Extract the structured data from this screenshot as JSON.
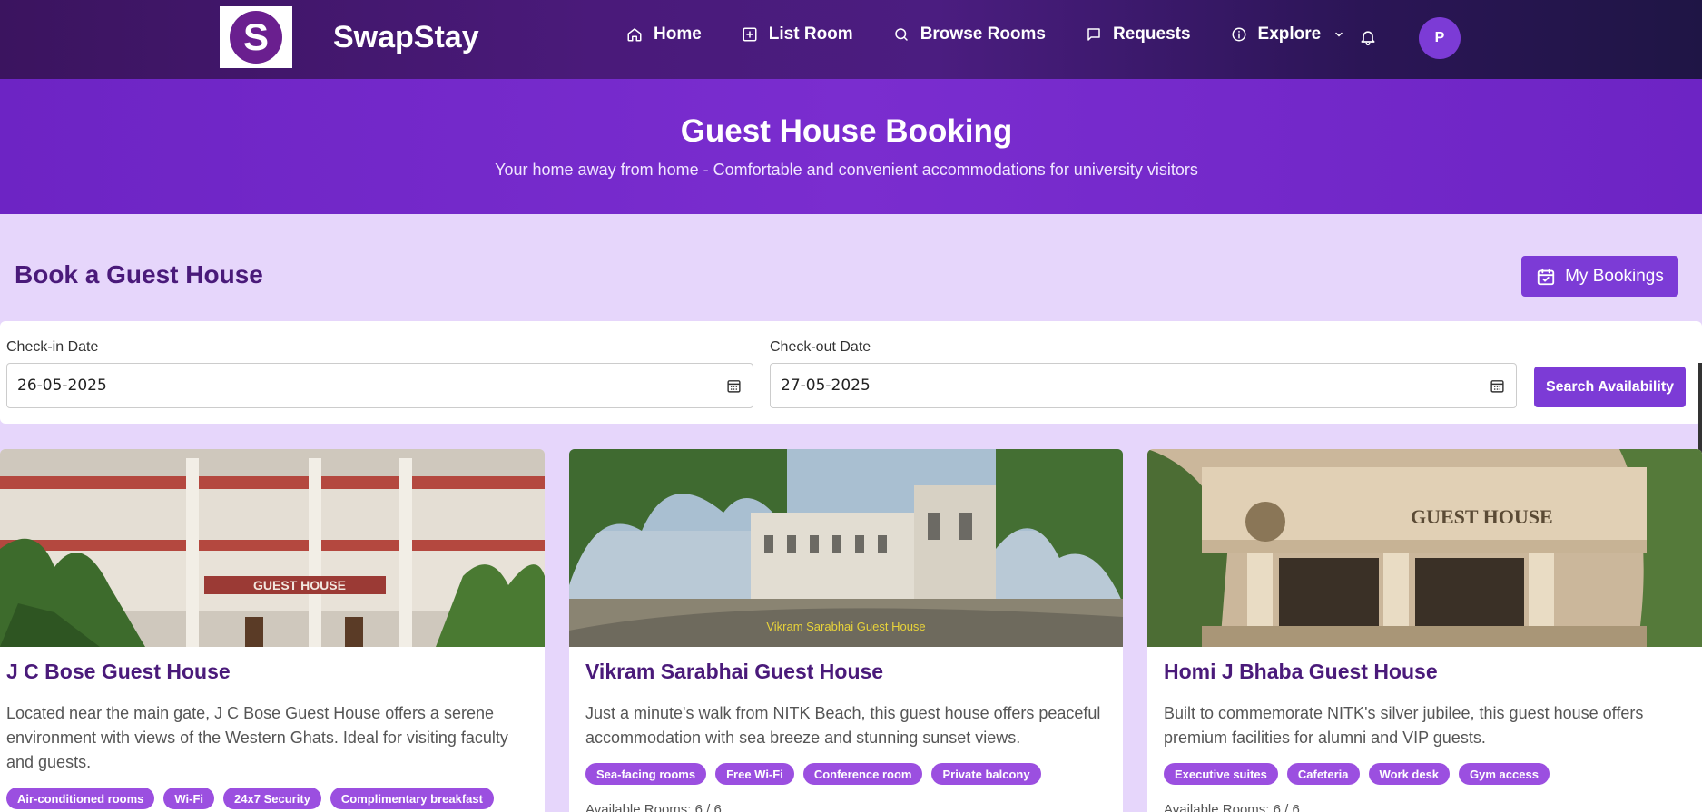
{
  "brand": {
    "logo_letter": "S",
    "name": "SwapStay"
  },
  "nav": {
    "items": [
      {
        "label": "Home",
        "icon": "home-icon"
      },
      {
        "label": "List Room",
        "icon": "plus-square-icon"
      },
      {
        "label": "Browse Rooms",
        "icon": "search-icon"
      },
      {
        "label": "Requests",
        "icon": "message-icon"
      },
      {
        "label": "Explore",
        "icon": "info-icon"
      }
    ],
    "avatar_initial": "P"
  },
  "hero": {
    "title": "Guest House Booking",
    "subtitle": "Your home away from home - Comfortable and convenient accommodations for university visitors"
  },
  "section": {
    "title": "Book a Guest House",
    "my_bookings_label": "My Bookings"
  },
  "search": {
    "checkin_label": "Check-in Date",
    "checkin_value": "26-05-2025",
    "checkout_label": "Check-out Date",
    "checkout_value": "27-05-2025",
    "button_label": "Search Availability"
  },
  "cards": [
    {
      "title": "J C Bose Guest House",
      "description": "Located near the main gate, J C Bose Guest House offers a serene environment with views of the Western Ghats. Ideal for visiting faculty and guests.",
      "image_sign": "GUEST HOUSE",
      "tags": [
        "Air-conditioned rooms",
        "Wi-Fi",
        "24x7 Security",
        "Complimentary breakfast"
      ]
    },
    {
      "title": "Vikram Sarabhai Guest House",
      "description": "Just a minute's walk from NITK Beach, this guest house offers peaceful accommodation with sea breeze and stunning sunset views.",
      "image_sign": "Vikram Sarabhai Guest House",
      "tags": [
        "Sea-facing rooms",
        "Free Wi-Fi",
        "Conference room",
        "Private balcony"
      ],
      "availability": "Available Rooms: 6 / 6"
    },
    {
      "title": "Homi J Bhaba Guest House",
      "description": "Built to commemorate NITK's silver jubilee, this guest house offers premium facilities for alumni and VIP guests.",
      "image_sign": "GUEST HOUSE",
      "tags": [
        "Executive suites",
        "Cafeteria",
        "Work desk",
        "Gym access"
      ],
      "availability": "Available Rooms: 6 / 6"
    }
  ],
  "colors": {
    "primary": "#7c3bd6",
    "title": "#4a1a7a",
    "tag": "#9b4fe0",
    "background": "#e6d6fb"
  }
}
